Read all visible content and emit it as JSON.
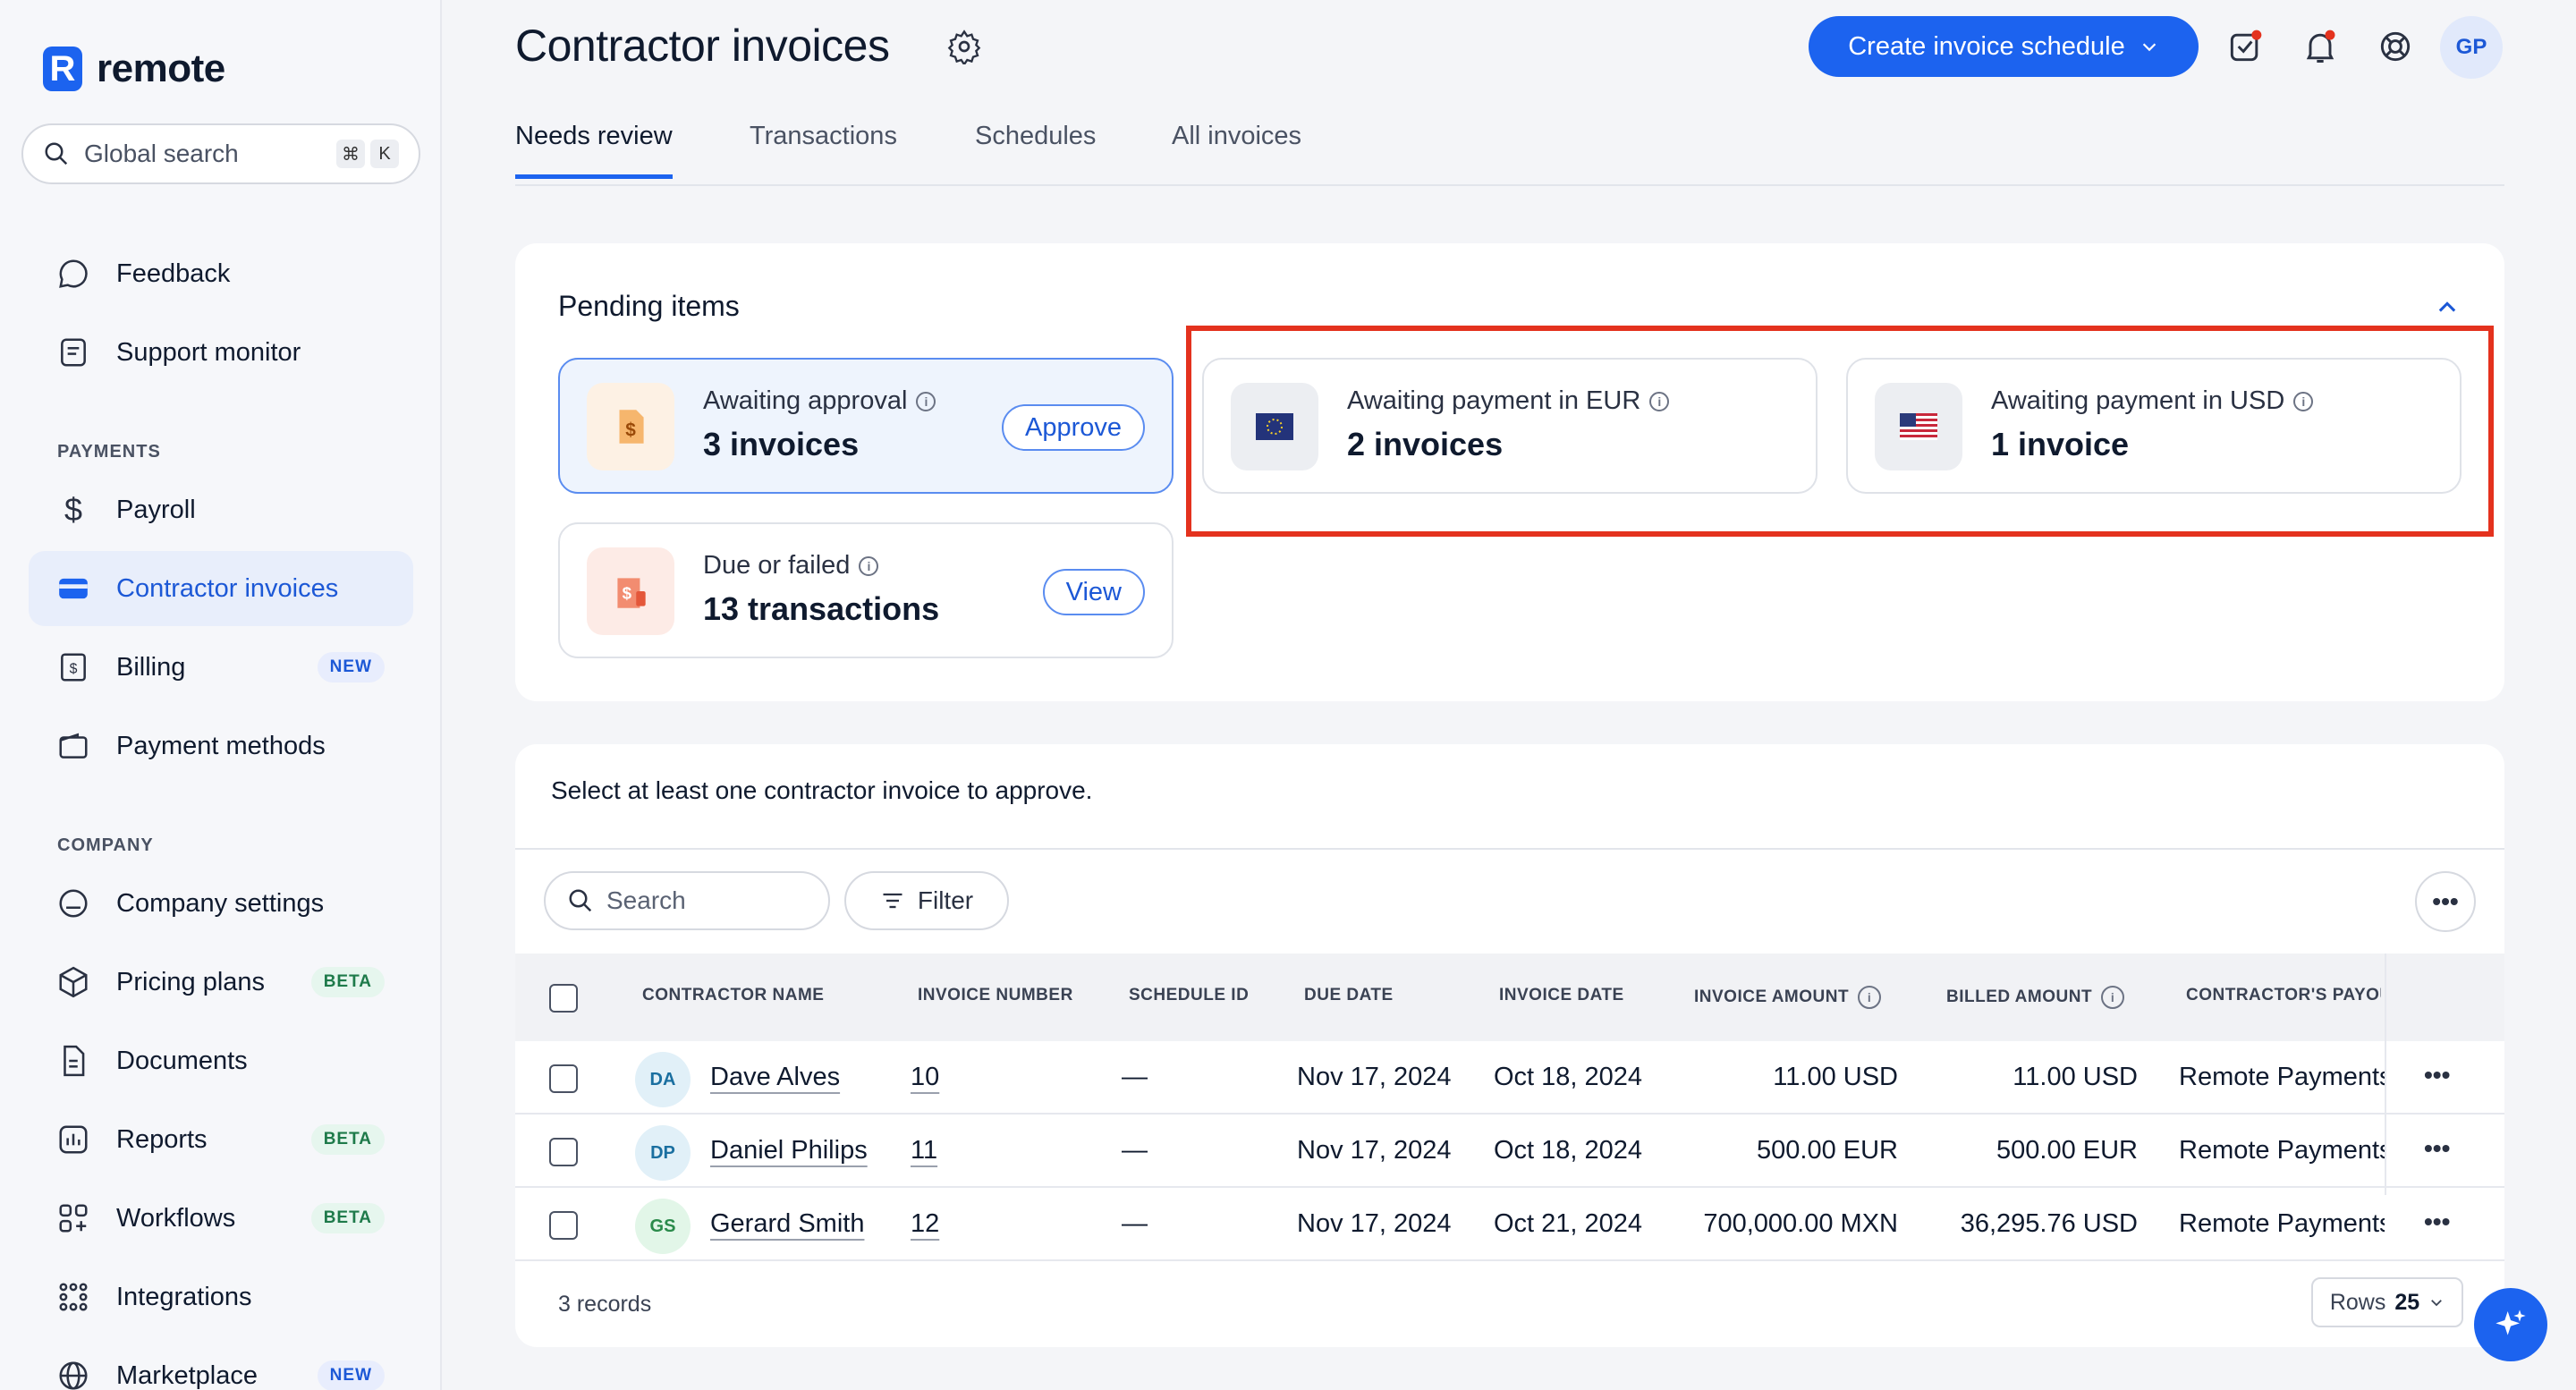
{
  "app": {
    "name": "remote"
  },
  "search": {
    "placeholder": "Global search",
    "shortcut_cmd": "⌘",
    "shortcut_key": "K"
  },
  "sidebar": {
    "items": [
      {
        "label": "Feedback"
      },
      {
        "label": "Support monitor"
      },
      {
        "label": "Payroll"
      },
      {
        "label": "Contractor invoices"
      },
      {
        "label": "Billing",
        "badge": "NEW"
      },
      {
        "label": "Payment methods"
      },
      {
        "label": "Company settings"
      },
      {
        "label": "Pricing plans",
        "badge": "BETA"
      },
      {
        "label": "Documents"
      },
      {
        "label": "Reports",
        "badge": "BETA"
      },
      {
        "label": "Workflows",
        "badge": "BETA"
      },
      {
        "label": "Integrations"
      },
      {
        "label": "Marketplace",
        "badge": "NEW"
      }
    ],
    "sections": {
      "payments": "PAYMENTS",
      "company": "COMPANY"
    }
  },
  "header": {
    "title": "Contractor invoices",
    "create_button": "Create invoice schedule",
    "avatar_initials": "GP"
  },
  "tabs": [
    {
      "label": "Needs review",
      "active": true
    },
    {
      "label": "Transactions"
    },
    {
      "label": "Schedules"
    },
    {
      "label": "All invoices"
    }
  ],
  "pending": {
    "title": "Pending items",
    "tiles": [
      {
        "label": "Awaiting approval",
        "value": "3 invoices",
        "button": "Approve"
      },
      {
        "label": "Awaiting payment in EUR",
        "value": "2 invoices"
      },
      {
        "label": "Awaiting payment in USD",
        "value": "1 invoice"
      },
      {
        "label": "Due or failed",
        "value": "13 transactions",
        "button": "View"
      }
    ]
  },
  "table": {
    "message": "Select at least one contractor invoice to approve.",
    "search_placeholder": "Search",
    "filter_label": "Filter",
    "columns": [
      "CONTRACTOR NAME",
      "INVOICE NUMBER",
      "SCHEDULE ID",
      "DUE DATE",
      "INVOICE DATE",
      "INVOICE AMOUNT",
      "BILLED AMOUNT",
      "CONTRACTOR'S PAYOU"
    ],
    "rows": [
      {
        "initials": "DA",
        "name": "Dave Alves",
        "invoice_number": "10",
        "schedule_id": "—",
        "due_date": "Nov 17, 2024",
        "invoice_date": "Oct 18, 2024",
        "invoice_amount": "11.00 USD",
        "billed_amount": "11.00 USD",
        "payout": "Remote Payments"
      },
      {
        "initials": "DP",
        "name": "Daniel Philips",
        "invoice_number": "11",
        "schedule_id": "—",
        "due_date": "Nov 17, 2024",
        "invoice_date": "Oct 18, 2024",
        "invoice_amount": "500.00 EUR",
        "billed_amount": "500.00 EUR",
        "payout": "Remote Payments"
      },
      {
        "initials": "GS",
        "name": "Gerard Smith",
        "invoice_number": "12",
        "schedule_id": "—",
        "due_date": "Nov 17, 2024",
        "invoice_date": "Oct 21, 2024",
        "invoice_amount": "700,000.00 MXN",
        "billed_amount": "36,295.76 USD",
        "payout": "Remote Payments"
      }
    ],
    "records": "3 records",
    "rows_label": "Rows",
    "rows_value": "25"
  },
  "colors": {
    "accent": "#1c63ef",
    "highlight_box": "#e4321e"
  }
}
